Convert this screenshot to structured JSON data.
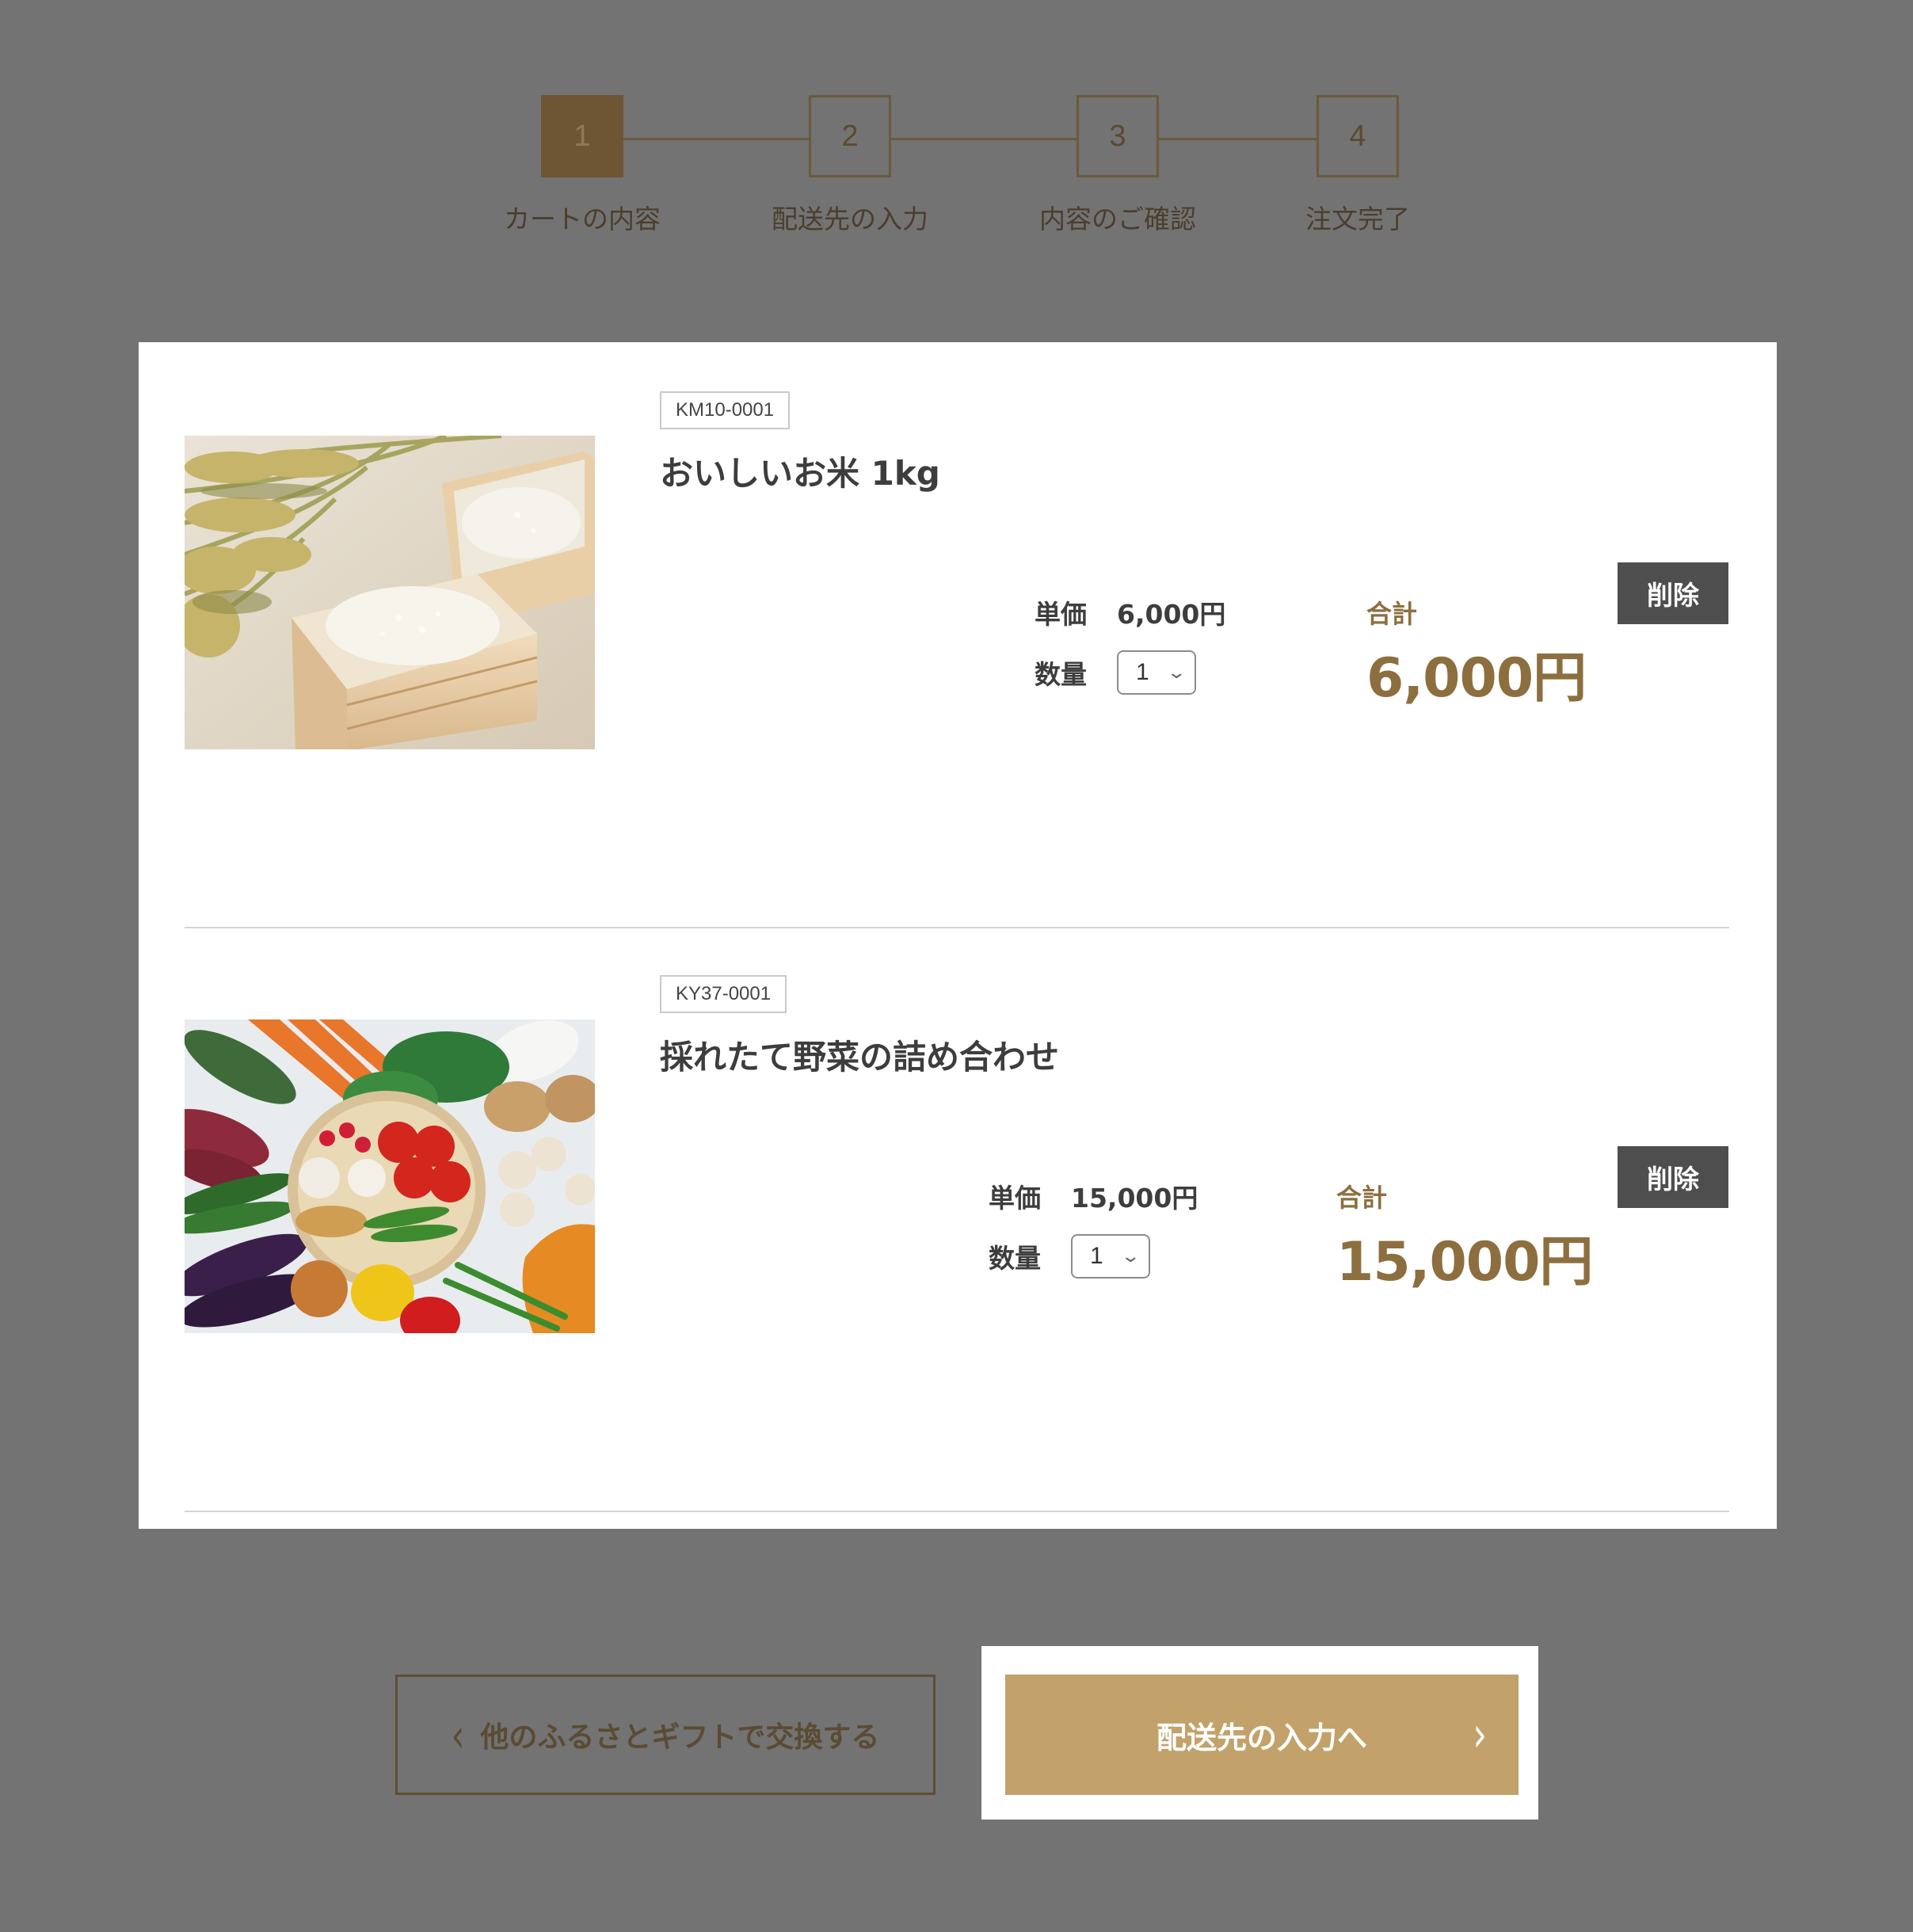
{
  "stepper": {
    "steps": [
      {
        "number": "1",
        "label": "カートの内容",
        "active": true
      },
      {
        "number": "2",
        "label": "配送先の入力",
        "active": false
      },
      {
        "number": "3",
        "label": "内容のご確認",
        "active": false
      },
      {
        "number": "4",
        "label": "注文完了",
        "active": false
      }
    ]
  },
  "cart": {
    "items": [
      {
        "code": "KM10-0001",
        "name": "おいしいお米 1kg",
        "unit_price_label": "単価",
        "unit_price": "6,000円",
        "quantity_label": "数量",
        "quantity": "1",
        "total_label": "合計",
        "total": "6,000円",
        "delete_label": "削除",
        "image": "rice-photo"
      },
      {
        "code": "KY37-0001",
        "name": "採れたて野菜の詰め合わせ",
        "unit_price_label": "単価",
        "unit_price": "15,000円",
        "quantity_label": "数量",
        "quantity": "1",
        "total_label": "合計",
        "total": "15,000円",
        "delete_label": "削除",
        "image": "vegetables-photo"
      }
    ]
  },
  "actions": {
    "back_label": "他のふるさとギフトで交換する",
    "next_label": "配送先の入力へ"
  },
  "colors": {
    "page_background": "#737373",
    "accent_gold": "#c2a26a",
    "total_brown": "#8d6e3e",
    "delete_button": "#4e4e4e"
  }
}
